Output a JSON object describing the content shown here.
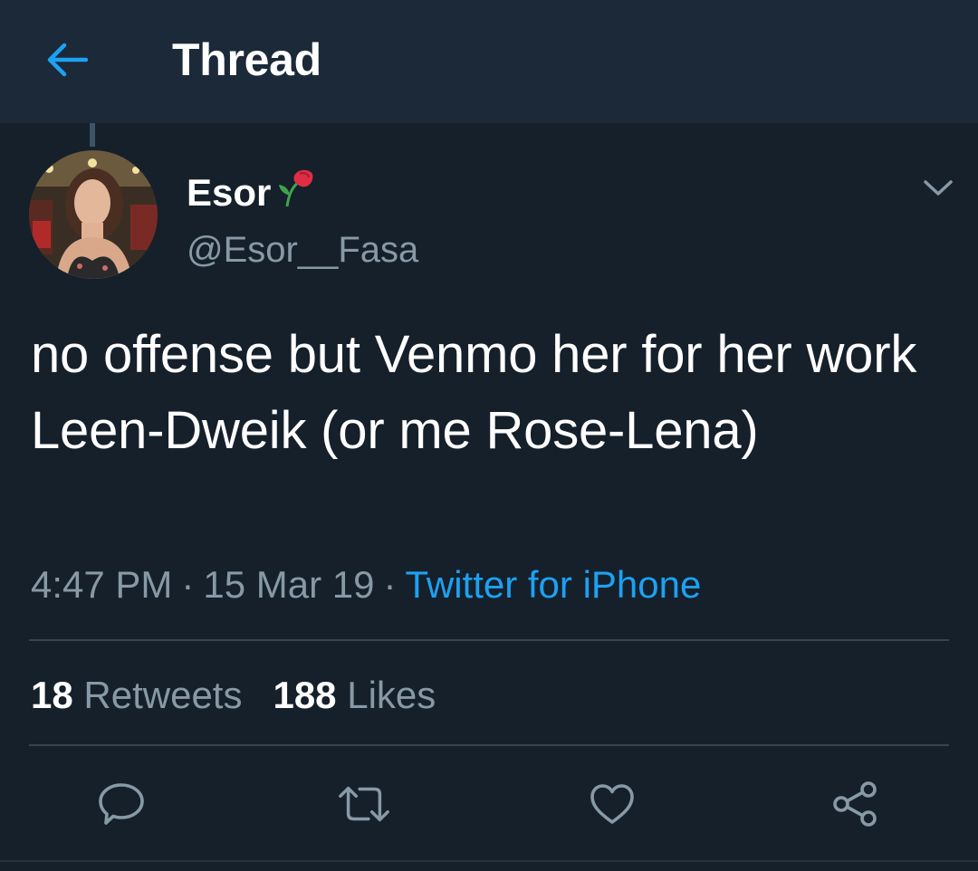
{
  "header": {
    "title": "Thread",
    "back_icon": "arrow-left-icon",
    "accent_color": "#1da1f2"
  },
  "tweet": {
    "author": {
      "display_name": "Esor",
      "name_emoji_icon": "rose-icon",
      "handle": "@Esor__Fasa",
      "avatar_icon": "profile-photo"
    },
    "text": "no offense but Venmo her for her work Leen-Dweik (or me Rose-Lena)",
    "time": "4:47 PM",
    "separator": "·",
    "date": "15 Mar 19",
    "source": "Twitter for iPhone",
    "stats": {
      "retweets_count": "18",
      "retweets_label": "Retweets",
      "likes_count": "188",
      "likes_label": "Likes"
    },
    "actions": [
      "reply-icon",
      "retweet-icon",
      "like-icon",
      "share-icon"
    ]
  },
  "colors": {
    "background": "#15202b",
    "header_background": "#1c2938",
    "secondary_text": "#8899a6",
    "divider": "#38444d"
  }
}
